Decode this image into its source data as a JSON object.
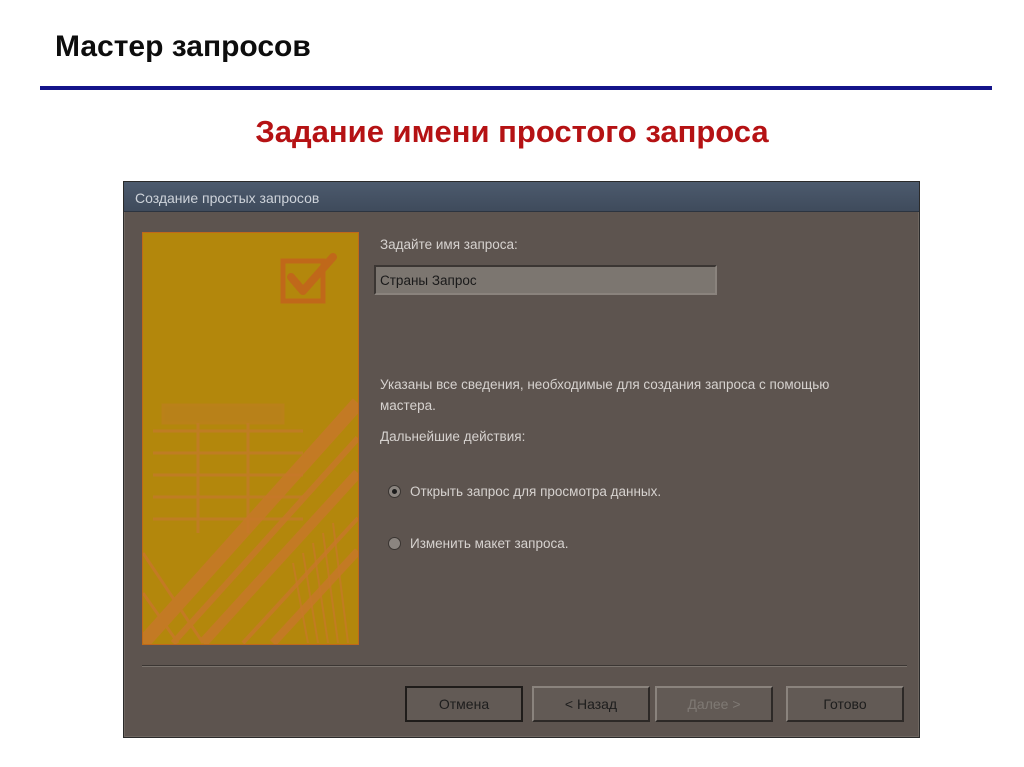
{
  "slide": {
    "title": "Мастер запросов",
    "subtitle": "Задание имени простого запроса"
  },
  "dialog": {
    "title": "Создание простых запросов",
    "name_label": "Задайте имя запроса:",
    "name_value": "Страны Запрос",
    "info_text": "Указаны все сведения, необходимые для создания запроса с помощью мастера.",
    "next_actions_label": "Дальнейшие действия:",
    "options": [
      {
        "label": "Открыть запрос для просмотра данных.",
        "checked": true
      },
      {
        "label": "Изменить макет запроса.",
        "checked": false
      }
    ],
    "buttons": {
      "cancel": "Отмена",
      "back": "< Назад",
      "next": "Далее >",
      "finish": "Готово"
    }
  },
  "colors": {
    "title_rule": "#14148a",
    "subtitle": "#b51214",
    "dialog_bg": "#5d544f",
    "wizard_image": "#b3870c"
  },
  "icons": {
    "wizard_image": "checkmark-icon"
  }
}
